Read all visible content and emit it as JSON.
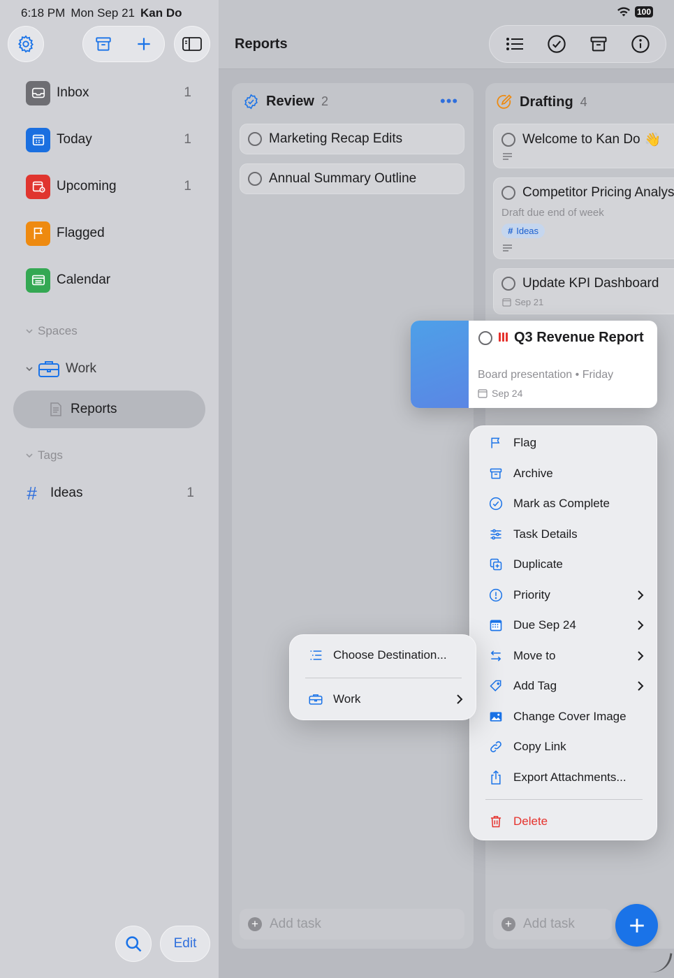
{
  "status_bar": {
    "time": "6:18 PM",
    "date": "Mon Sep 21",
    "app_name": "Kan Do",
    "battery": "100"
  },
  "sidebar": {
    "nav": [
      {
        "label": "Inbox",
        "count": "1",
        "icon": "tray-icon",
        "color": "#6e6e73"
      },
      {
        "label": "Today",
        "count": "1",
        "icon": "calendar-today-icon",
        "color": "#1a6fe0"
      },
      {
        "label": "Upcoming",
        "count": "1",
        "icon": "calendar-clock-icon",
        "color": "#e0352f"
      },
      {
        "label": "Flagged",
        "count": "",
        "icon": "flag-icon",
        "color": "#ee8a10"
      },
      {
        "label": "Calendar",
        "count": "",
        "icon": "calendar-icon",
        "color": "#34a853"
      }
    ],
    "spaces_header": "Spaces",
    "space": {
      "label": "Work",
      "icon": "briefcase-icon"
    },
    "board": {
      "label": "Reports",
      "icon": "document-icon"
    },
    "tags_header": "Tags",
    "tag": {
      "symbol": "#",
      "label": "Ideas",
      "count": "1"
    },
    "edit_label": "Edit"
  },
  "main": {
    "title": "Reports",
    "columns": [
      {
        "title": "Review",
        "count": "2",
        "cards": [
          {
            "title": "Marketing Recap Edits"
          },
          {
            "title": "Annual Summary Outline"
          }
        ],
        "add_task": "Add task"
      },
      {
        "title": "Drafting",
        "count": "4",
        "cards": [
          {
            "title": "Welcome to Kan Do",
            "emoji": "👋"
          },
          {
            "title": "Competitor Pricing Analys",
            "notes": "Draft due end of week",
            "tag": "Ideas"
          },
          {
            "title": "Update KPI Dashboard",
            "due": "Sep 21"
          }
        ],
        "add_task": "Add task"
      }
    ]
  },
  "lifted_card": {
    "title": "Q3 Revenue Report",
    "notes": "Board presentation • Friday",
    "due": "Sep 24",
    "priority_color": "#e5322d"
  },
  "context_menu": {
    "items": [
      {
        "label": "Flag",
        "icon": "flag-icon"
      },
      {
        "label": "Archive",
        "icon": "archive-icon"
      },
      {
        "label": "Mark as Complete",
        "icon": "checkmark-circle-icon"
      },
      {
        "label": "Task Details",
        "icon": "sliders-icon"
      },
      {
        "label": "Duplicate",
        "icon": "duplicate-icon"
      },
      {
        "label": "Priority",
        "icon": "exclamation-circle-icon"
      },
      {
        "label": "Due Sep 24",
        "icon": "calendar-icon"
      },
      {
        "label": "Move to",
        "icon": "move-arrows-icon"
      },
      {
        "label": "Add Tag",
        "icon": "tag-icon"
      },
      {
        "label": "Change Cover Image",
        "icon": "photo-icon"
      },
      {
        "label": "Copy Link",
        "icon": "link-icon"
      },
      {
        "label": "Export Attachments...",
        "icon": "share-icon"
      }
    ],
    "delete_label": "Delete"
  },
  "submenu": {
    "choose_label": "Choose Destination...",
    "work_label": "Work"
  },
  "colors": {
    "accent": "#1a73e8",
    "destructive": "#e5322d"
  }
}
